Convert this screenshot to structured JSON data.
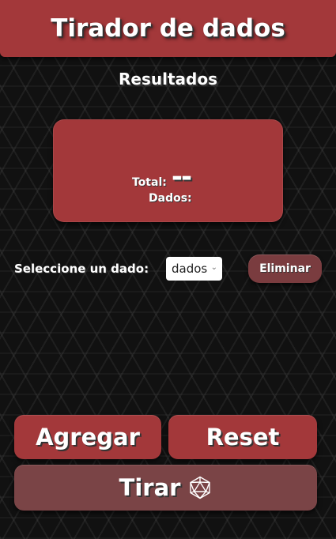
{
  "header": {
    "title": "Tirador de dados"
  },
  "results": {
    "title": "Resultados",
    "total_label": "Total:",
    "total_value": "--",
    "dice_label": "Dados:"
  },
  "controls": {
    "select_label": "Seleccione un dado:",
    "select_value": "dados",
    "delete_label": "Eliminar"
  },
  "actions": {
    "add_label": "Agregar",
    "reset_label": "Reset",
    "roll_label": "Tirar",
    "roll_icon": "d20-icon"
  },
  "colors": {
    "primary": "#a3383a",
    "secondary": "#7a3c3f",
    "background": "#111111"
  }
}
